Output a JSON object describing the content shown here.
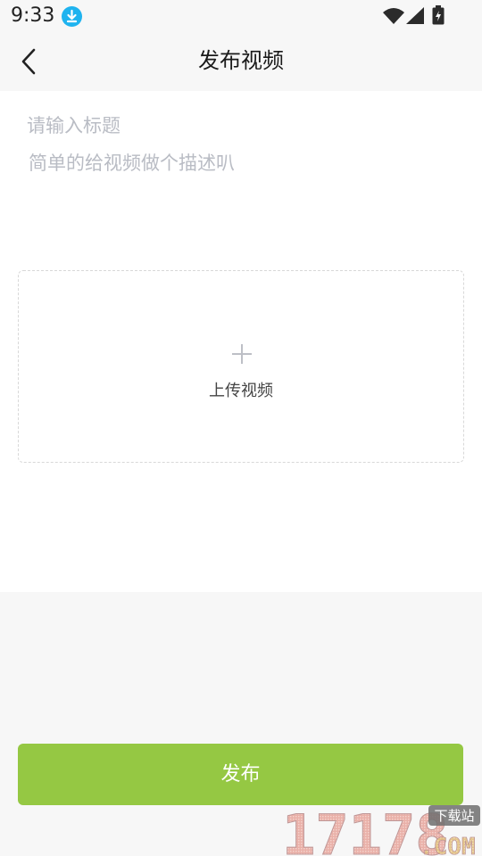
{
  "status_bar": {
    "time": "9:33",
    "icons": [
      "download-icon",
      "wifi-icon",
      "signal-icon",
      "battery-icon"
    ]
  },
  "header": {
    "back_icon": "chevron-left-icon",
    "title": "发布视频"
  },
  "form": {
    "title_placeholder": "请输入标题",
    "title_value": "",
    "description_placeholder": "简单的给视频做个描述叭",
    "description_value": ""
  },
  "upload": {
    "icon": "plus-icon",
    "label": "上传视频"
  },
  "publish_button": {
    "label": "发布"
  },
  "watermark": {
    "text": "17178.COM",
    "badge": "下载站"
  },
  "colors": {
    "accent_green": "#95c843",
    "download_badge": "#1fb3ef",
    "placeholder": "#b9bcc4",
    "background": "#f7f7f7"
  }
}
